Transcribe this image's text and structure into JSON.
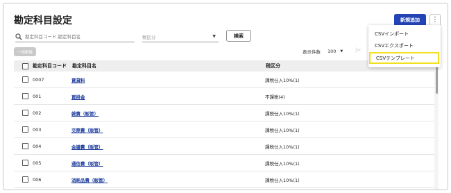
{
  "header": {
    "title": "勘定科目設定",
    "new_button": "新規追加",
    "more_button": "⋮"
  },
  "filters": {
    "search_placeholder": "勘定科目コード,勘定科目名",
    "tax_placeholder": "税区分",
    "search_button": "検索"
  },
  "toolbar": {
    "bulk_delete": "一括削除",
    "per_page_label": "表示件数",
    "per_page_value": "100",
    "first_page": "|<"
  },
  "table": {
    "columns": [
      "勘定科目コード",
      "勘定科目名",
      "税区分"
    ],
    "rows": [
      {
        "code": "0007",
        "name": "賃貸料",
        "tax": "課税仕入10%(1)"
      },
      {
        "code": "001",
        "name": "買掛金",
        "tax": "不課税(4)"
      },
      {
        "code": "002",
        "name": "雑費（販管）",
        "tax": "課税仕入10%(1)"
      },
      {
        "code": "003",
        "name": "交際費（販管）",
        "tax": "課税仕入10%(1)"
      },
      {
        "code": "004",
        "name": "会議費（販管）",
        "tax": "課税仕入10%(1)"
      },
      {
        "code": "005",
        "name": "通信費（販管）",
        "tax": "課税仕入10%(1)"
      },
      {
        "code": "006",
        "name": "消耗品費（販管）",
        "tax": "課税仕入10%(1)"
      }
    ]
  },
  "menu": {
    "items": [
      "CSVインポート",
      "CSVエクスポート",
      "CSVテンプレート"
    ],
    "highlighted_index": 2
  },
  "colors": {
    "primary": "#2443b5",
    "link": "#1f3d9e",
    "highlight_border": "#f2e01c"
  }
}
